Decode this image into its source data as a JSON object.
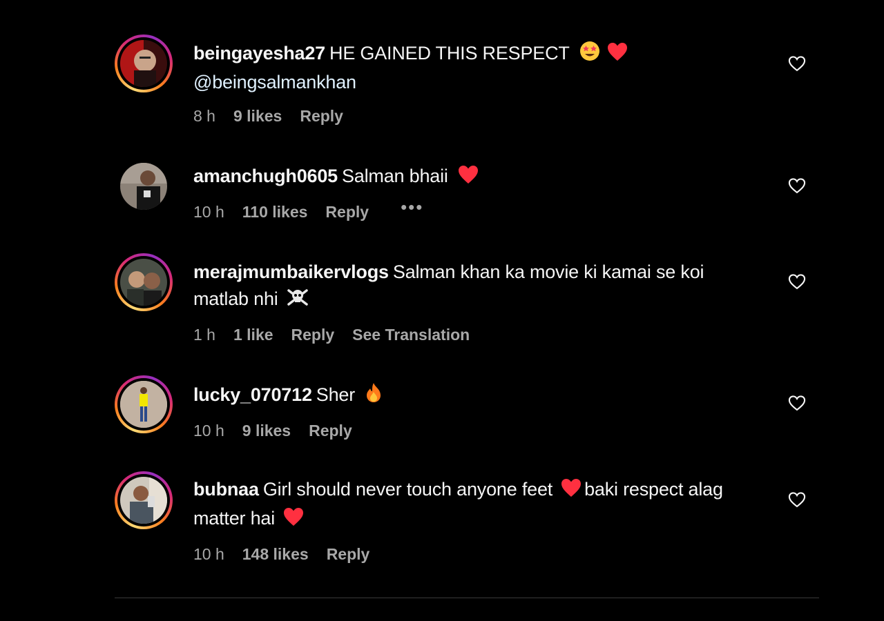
{
  "comments": [
    {
      "username": "beingayesha27",
      "text": "HE GAINED THIS RESPECT",
      "mention": "@beingsalmankhan",
      "time": "8 h",
      "likes": "9 likes",
      "reply": "Reply"
    },
    {
      "username": "amanchugh0605",
      "text": "Salman bhaii",
      "time": "10 h",
      "likes": "110 likes",
      "reply": "Reply",
      "more": "•••"
    },
    {
      "username": "merajmumbaikervlogs",
      "text": "Salman khan ka movie ki kamai se koi matlab nhi",
      "time": "1 h",
      "likes": "1 like",
      "reply": "Reply",
      "translate": "See Translation"
    },
    {
      "username": "lucky_070712",
      "text": "Sher",
      "time": "10 h",
      "likes": "9 likes",
      "reply": "Reply"
    },
    {
      "username": "bubnaa",
      "text": "Girl should never touch anyone feet",
      "text_cont": "baki respect alag matter hai",
      "time": "10 h",
      "likes": "148 likes",
      "reply": "Reply"
    }
  ],
  "icons": {
    "like": "heart-outline-icon",
    "heart_emoji": "red-heart-emoji",
    "star_eyes_emoji": "star-struck-emoji",
    "skull_emoji": "skull-crossbones-emoji",
    "fire_emoji": "fire-emoji"
  },
  "colors": {
    "background": "#000000",
    "text": "#f5f5f5",
    "meta": "#a8a8a8",
    "heart": "#ff3040"
  }
}
